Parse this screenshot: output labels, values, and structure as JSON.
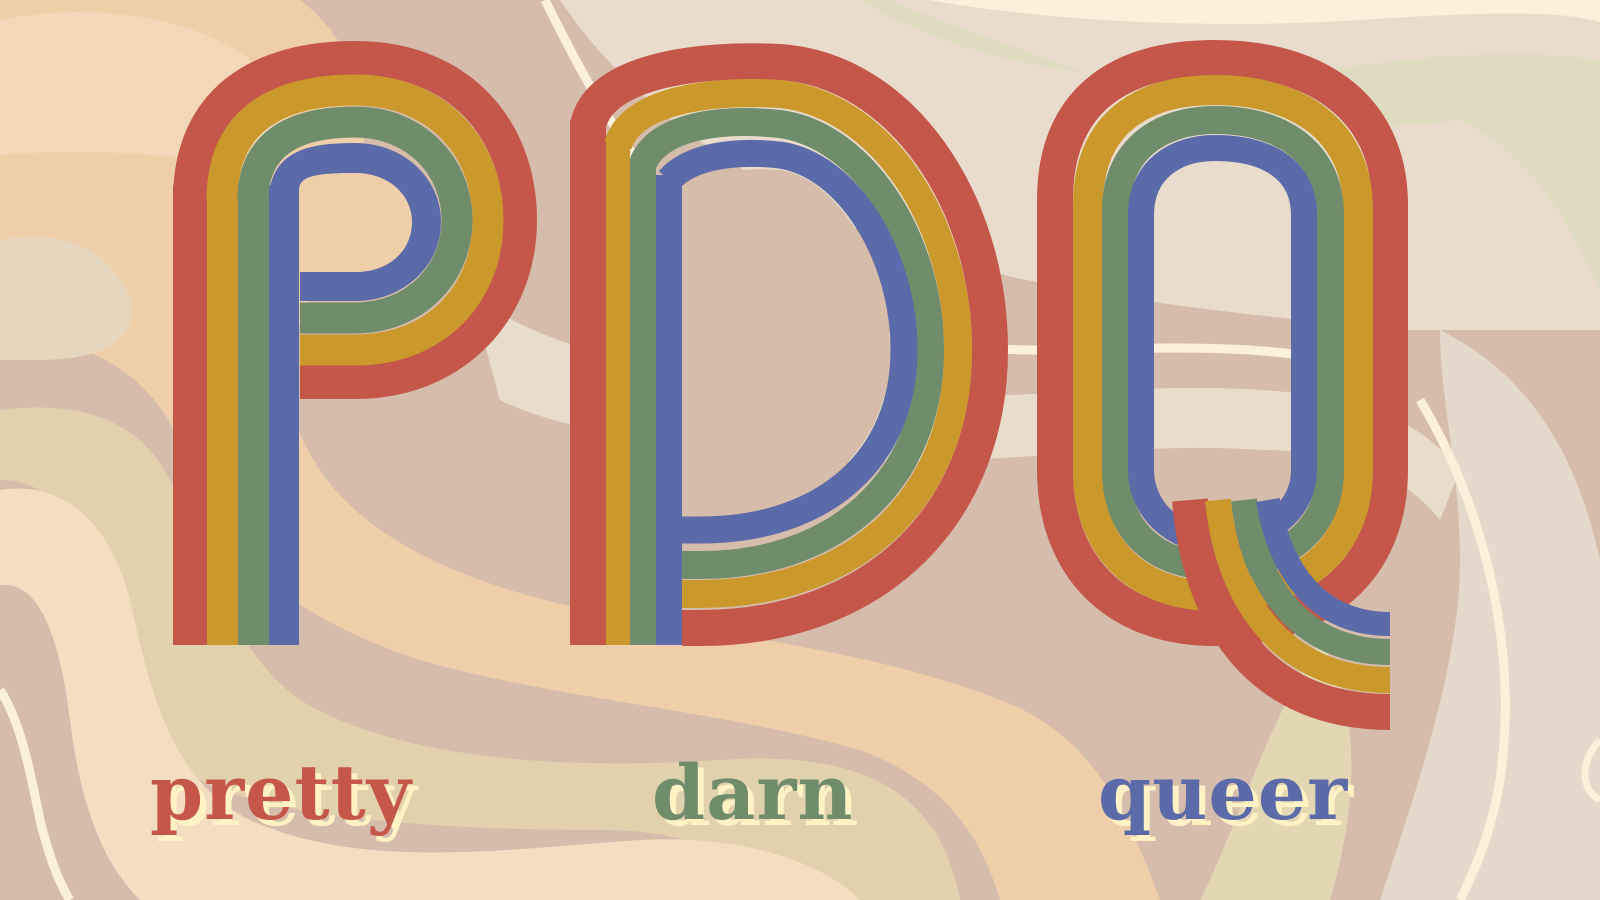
{
  "monogram": {
    "letters": [
      "P",
      "D",
      "Q"
    ]
  },
  "tagline": {
    "words": [
      "pretty",
      "darn",
      "queer"
    ]
  },
  "colors": {
    "background_waves": [
      "#d6bcab",
      "#efcfa9",
      "#e6dbc9",
      "#e0d2ae",
      "#f4dec1",
      "#e3d6b2",
      "#fbf1da",
      "#ead9cc",
      "#dfdcc2"
    ],
    "rainbow_stripes": [
      "#c5574a",
      "#cb982b",
      "#6f8c6b",
      "#5b6aa8"
    ],
    "word_shadow": "#fff2c4"
  }
}
